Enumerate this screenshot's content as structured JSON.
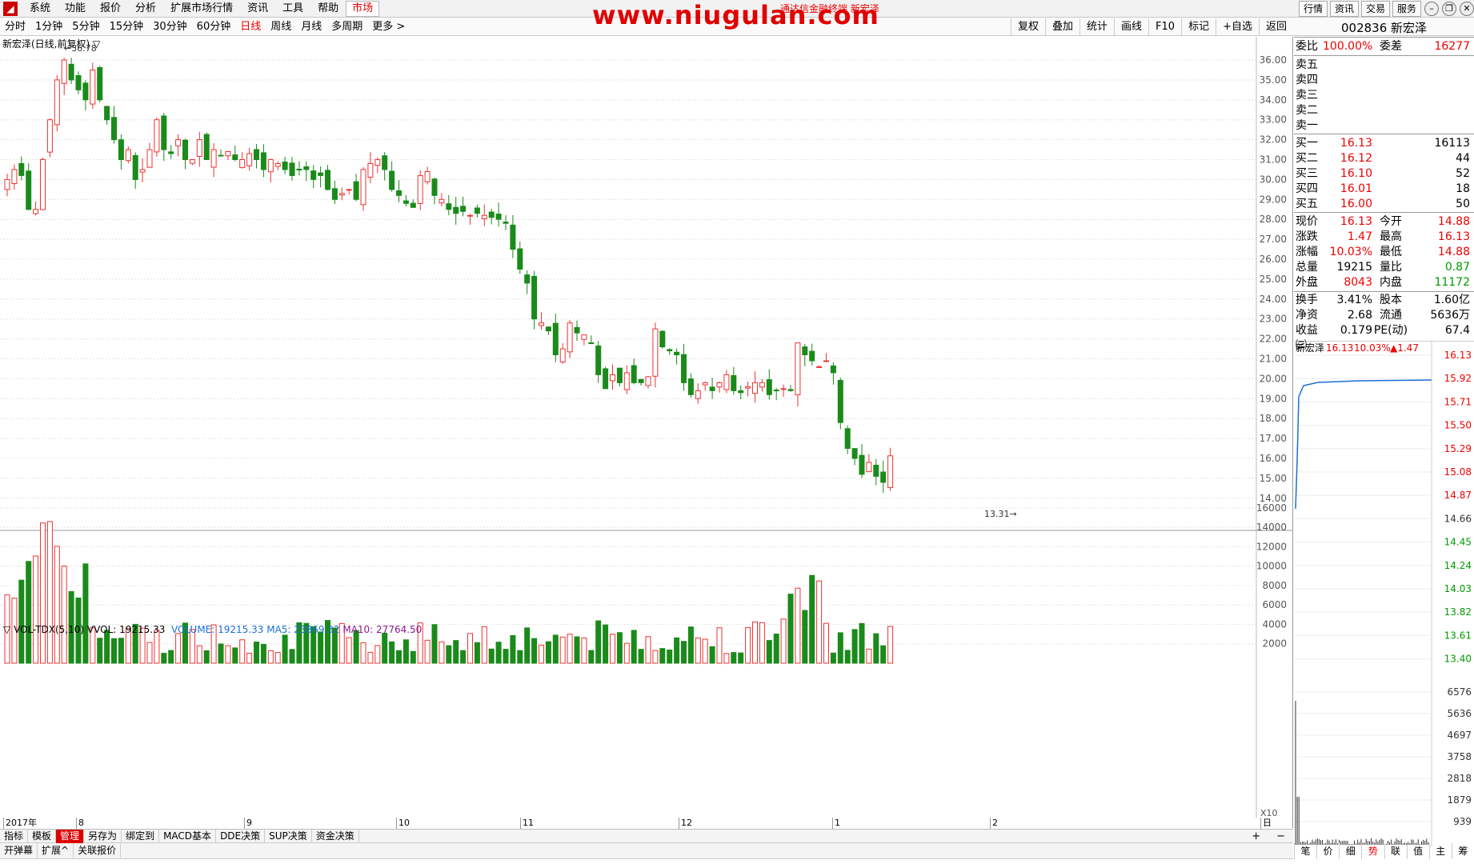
{
  "menubar": {
    "items": [
      "系统",
      "功能",
      "报价",
      "分析",
      "扩展市场行情",
      "资讯",
      "工具",
      "帮助",
      "市场"
    ],
    "watermark": "www.niugulan.com",
    "ticker": "通达信金融终端  新宏泽",
    "right_buttons": [
      "行情",
      "资讯",
      "交易",
      "服务"
    ]
  },
  "periods": [
    "分时",
    "1分钟",
    "5分钟",
    "15分钟",
    "30分钟",
    "60分钟",
    "日线",
    "周线",
    "月线",
    "多周期",
    "更多 >"
  ],
  "tools": [
    "复权",
    "叠加",
    "统计",
    "画线",
    "F10",
    "标记",
    "+自选",
    "返回"
  ],
  "chart": {
    "title": "新宏泽(日线,前复权)",
    "high_label": "36.78",
    "low_label": "13.31",
    "price_ticks": [
      "36.00",
      "35.00",
      "34.00",
      "33.00",
      "32.00",
      "31.00",
      "30.00",
      "29.00",
      "28.00",
      "27.00",
      "26.00",
      "25.00",
      "24.00",
      "23.00",
      "22.00",
      "21.00",
      "20.00",
      "19.00",
      "18.00",
      "17.00",
      "16.00",
      "15.00",
      "14.00"
    ],
    "vol_ticks": [
      "16000",
      "14000",
      "12000",
      "10000",
      "8000",
      "6000",
      "4000",
      "2000"
    ],
    "vol_unit": "X10",
    "x_labels": [
      "2017年",
      "8",
      "9",
      "10",
      "11",
      "12",
      "1",
      "2"
    ],
    "axis_label": "日线"
  },
  "volheader": {
    "name": "VOL-TDX(5,10)",
    "vvol": "VVOL: 19215.33",
    "volume": "VOLUME: 19215.33",
    "ma5": "MA5: 23869.32",
    "ma10": "MA10: 27764.50"
  },
  "bottom_tabs": [
    "指标",
    "模板",
    "管理",
    "另存为",
    "绑定到",
    "MACD基本",
    "DDE决策",
    "SUP决策",
    "资金决策"
  ],
  "bottom2": [
    "开弹幕",
    "扩展^",
    "关联报价"
  ],
  "right": {
    "title": "002836 新宏泽",
    "weibi": {
      "label": "委比",
      "value": "100.00%",
      "label2": "委差",
      "value2": "16277"
    },
    "sell": [
      {
        "label": "卖五"
      },
      {
        "label": "卖四"
      },
      {
        "label": "卖三"
      },
      {
        "label": "卖二"
      },
      {
        "label": "卖一"
      }
    ],
    "buy": [
      {
        "label": "买一",
        "price": "16.13",
        "vol": "16113"
      },
      {
        "label": "买二",
        "price": "16.12",
        "vol": "44"
      },
      {
        "label": "买三",
        "price": "16.10",
        "vol": "52"
      },
      {
        "label": "买四",
        "price": "16.01",
        "vol": "18"
      },
      {
        "label": "买五",
        "price": "16.00",
        "vol": "50"
      }
    ],
    "quote": [
      {
        "l1": "现价",
        "v1": "16.13",
        "l2": "今开",
        "v2": "14.88",
        "c1": "red",
        "c2": "red"
      },
      {
        "l1": "涨跌",
        "v1": "1.47",
        "l2": "最高",
        "v2": "16.13",
        "c1": "red",
        "c2": "red"
      },
      {
        "l1": "涨幅",
        "v1": "10.03%",
        "l2": "最低",
        "v2": "14.88",
        "c1": "red",
        "c2": "red"
      },
      {
        "l1": "总量",
        "v1": "19215",
        "l2": "量比",
        "v2": "0.87",
        "c1": "black",
        "c2": "green"
      },
      {
        "l1": "外盘",
        "v1": "8043",
        "l2": "内盘",
        "v2": "11172",
        "c1": "red",
        "c2": "green"
      },
      {
        "l1": "换手",
        "v1": "3.41%",
        "l2": "股本",
        "v2": "1.60亿",
        "c1": "black",
        "c2": "black"
      },
      {
        "l1": "净资",
        "v1": "2.68",
        "l2": "流通",
        "v2": "5636万",
        "c1": "black",
        "c2": "black"
      },
      {
        "l1": "收益㈢",
        "v1": "0.179",
        "l2": "PE(动)",
        "v2": "67.4",
        "c1": "black",
        "c2": "black"
      }
    ],
    "mini": {
      "name": "新宏泽",
      "price": "16.13",
      "pct": "10.03%",
      "chg": "▲1.47",
      "ticks": [
        "16.13",
        "15.92",
        "15.71",
        "15.50",
        "15.29",
        "15.08",
        "14.87",
        "14.66",
        "14.45",
        "14.24",
        "14.03",
        "13.82",
        "13.61",
        "13.40"
      ],
      "vticks": [
        "6576",
        "5636",
        "4697",
        "3758",
        "2818",
        "1879",
        "939"
      ]
    },
    "tabs": [
      "笔",
      "价",
      "细",
      "势",
      "联",
      "值",
      "主",
      "筹"
    ]
  }
}
